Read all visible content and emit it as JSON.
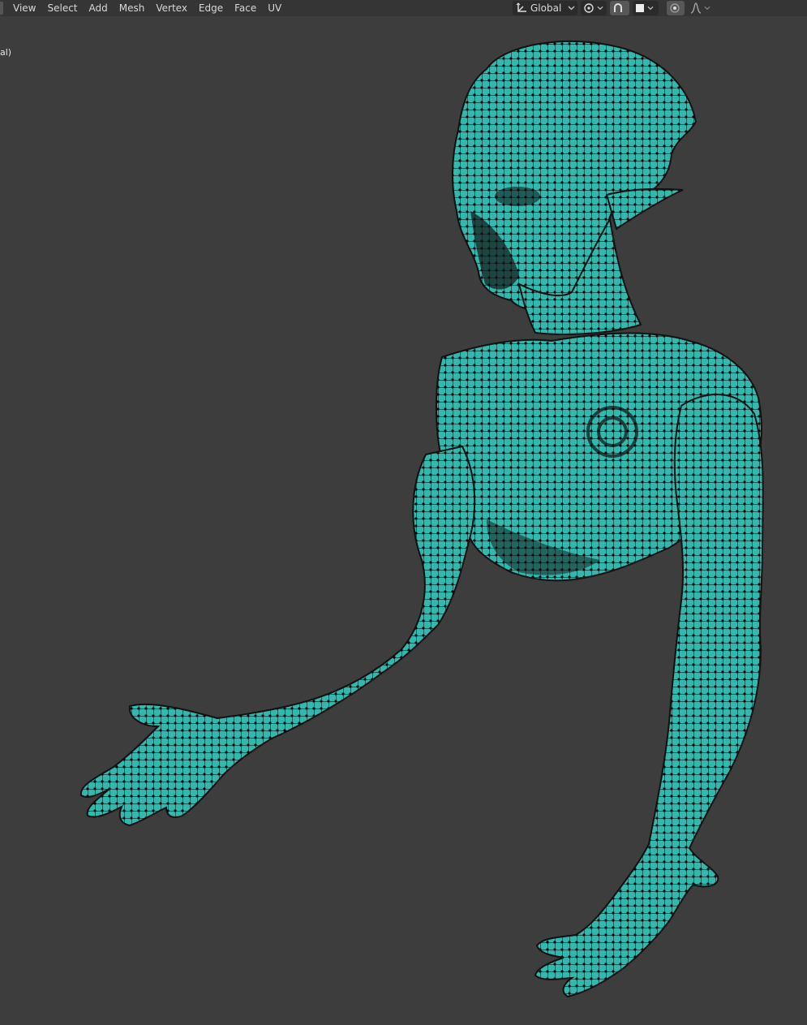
{
  "header": {
    "menus": [
      "View",
      "Select",
      "Add",
      "Mesh",
      "Vertex",
      "Edge",
      "Face",
      "UV"
    ],
    "orientation_label": "Global"
  },
  "overlay": {
    "mode_text_fragment": "al)"
  },
  "icons": {
    "orientation": "transform-orientation-icon",
    "pivot": "pivot-point-icon",
    "snap": "snap-magnet-icon",
    "snap_target": "snap-target-icon",
    "proportional": "proportional-editing-icon",
    "falloff": "falloff-curve-icon"
  },
  "colors": {
    "background": "#3d3d3d",
    "mesh_face": "#34b7ad",
    "mesh_wire": "#111111",
    "header_text": "#d8d8d8"
  }
}
